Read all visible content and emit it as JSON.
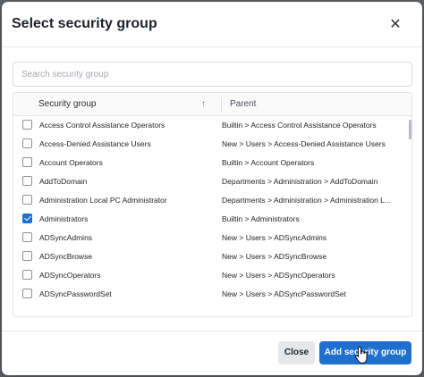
{
  "dialog": {
    "title": "Select security group",
    "close_icon": "close-icon"
  },
  "search": {
    "placeholder": "Search security group",
    "value": ""
  },
  "table": {
    "columns": {
      "group": "Security group",
      "parent": "Parent",
      "sort_icon": "sort-ascending-icon",
      "sort_glyph": "↑"
    },
    "rows": [
      {
        "name": "Access Control Assistance Operators",
        "parent": "Builtin > Access Control Assistance Operators",
        "checked": false
      },
      {
        "name": "Access-Denied Assistance Users",
        "parent": "New > Users > Access-Denied Assistance Users",
        "checked": false
      },
      {
        "name": "Account Operators",
        "parent": "Builtin > Account Operators",
        "checked": false
      },
      {
        "name": "AddToDomain",
        "parent": "Departments > Administration > AddToDomain",
        "checked": false
      },
      {
        "name": "Administration Local PC Administrator",
        "parent": "Departments > Administration > Administration L...",
        "checked": false
      },
      {
        "name": "Administrators",
        "parent": "Builtin > Administrators",
        "checked": true
      },
      {
        "name": "ADSyncAdmins",
        "parent": "New > Users > ADSyncAdmins",
        "checked": false
      },
      {
        "name": "ADSyncBrowse",
        "parent": "New > Users > ADSyncBrowse",
        "checked": false
      },
      {
        "name": "ADSyncOperators",
        "parent": "New > Users > ADSyncOperators",
        "checked": false
      },
      {
        "name": "ADSyncPasswordSet",
        "parent": "New > Users > ADSyncPasswordSet",
        "checked": false
      }
    ]
  },
  "footer": {
    "close_label": "Close",
    "add_label": "Add security group"
  },
  "colors": {
    "primary": "#1f6fcf",
    "checkbox_checked": "#1d6fd8",
    "secondary_button": "#e6e7e9"
  }
}
